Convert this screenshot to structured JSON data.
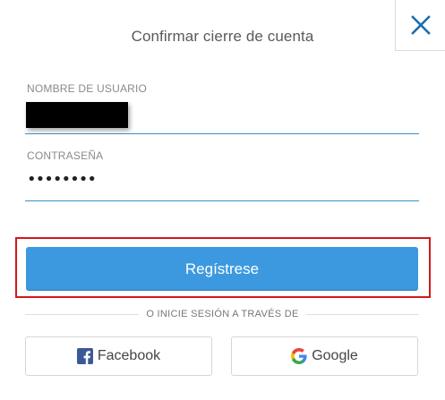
{
  "dialog": {
    "title": "Confirmar cierre de cuenta",
    "close_icon": "close-icon"
  },
  "form": {
    "username": {
      "label": "NOMBRE DE USUARIO",
      "value": ""
    },
    "password": {
      "label": "CONTRASEÑA",
      "masked_value": "••••••••"
    }
  },
  "actions": {
    "register_label": "Regístrese",
    "divider_text": "O INICIE SESIÓN A TRAVÉS DE",
    "facebook_label": "Facebook",
    "google_label": "Google"
  },
  "colors": {
    "accent": "#3c99df",
    "underline": "#3a8fc7",
    "highlight": "#d21919",
    "close": "#1a6fb5",
    "facebook": "#3b5998"
  }
}
